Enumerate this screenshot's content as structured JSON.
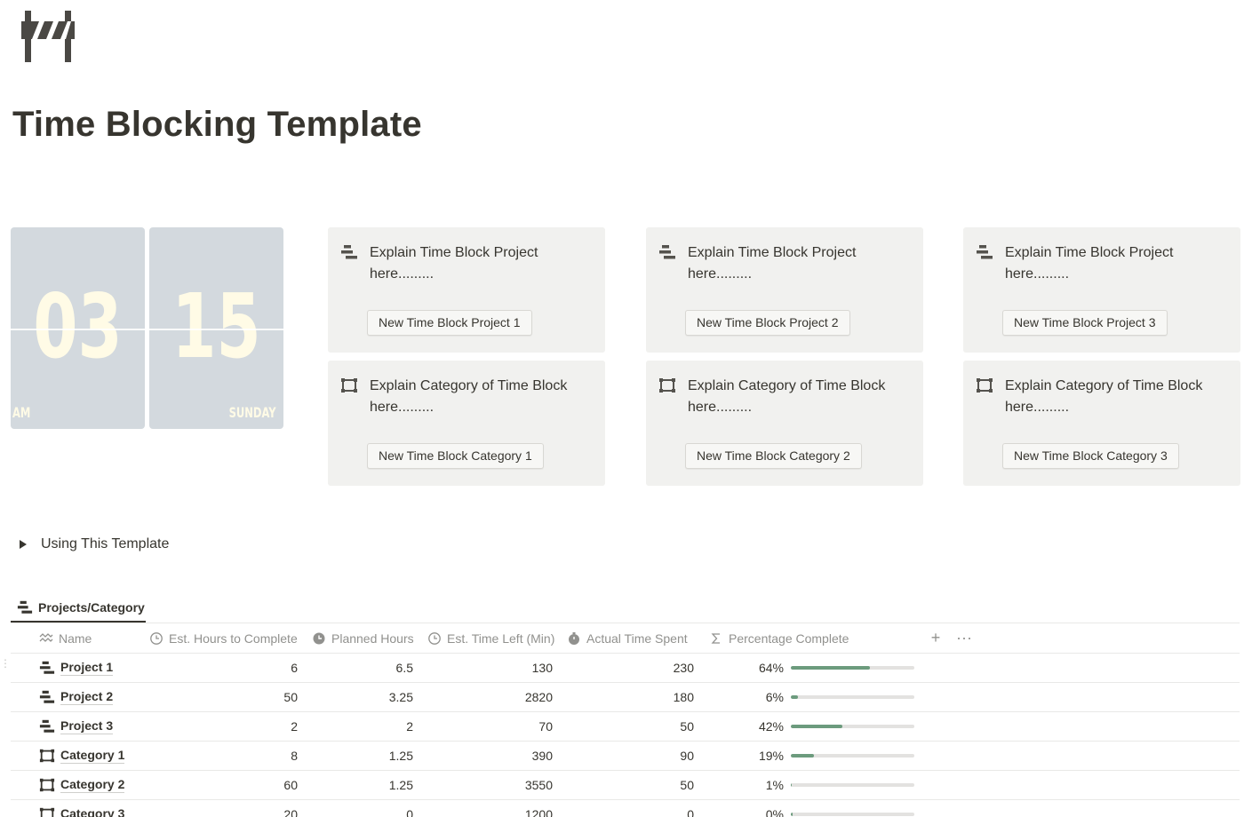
{
  "page": {
    "icon": "roadblock-icon",
    "title": "Time Blocking Template"
  },
  "clock": {
    "hour": "03",
    "minute": "15",
    "meridiem": "AM",
    "day": "SUNDAY"
  },
  "project_cards": [
    {
      "icon": "stacked-bars-icon",
      "text": "Explain Time Block Project here.........",
      "button": "New Time Block Project 1"
    },
    {
      "icon": "stacked-bars-icon",
      "text": "Explain Time Block Project here.........",
      "button": "New Time Block Project 2"
    },
    {
      "icon": "stacked-bars-icon",
      "text": "Explain Time Block Project here.........",
      "button": "New Time Block Project 3"
    }
  ],
  "category_cards": [
    {
      "icon": "frame-icon",
      "text": "Explain Category of Time Block here.........",
      "button": "New Time Block Category 1"
    },
    {
      "icon": "frame-icon",
      "text": "Explain Category of Time Block here.........",
      "button": "New Time Block Category 2"
    },
    {
      "icon": "frame-icon",
      "text": "Explain Category of Time Block here.........",
      "button": "New Time Block Category 3"
    }
  ],
  "toggle": {
    "label": "Using This Template"
  },
  "view": {
    "tab_label": "Projects/Category"
  },
  "table": {
    "columns": {
      "name": "Name",
      "est_hours": "Est. Hours to Complete",
      "planned_hours": "Planned Hours",
      "est_time_left": "Est. Time Left (Min)",
      "actual_time": "Actual Time Spent",
      "percentage": "Percentage Complete"
    },
    "rows": [
      {
        "type": "project",
        "name": "Project 1",
        "est_hours": "6",
        "planned_hours": "6.5",
        "est_time_left": "130",
        "actual_time": "230",
        "percent_label": "64%",
        "percent": 0.64
      },
      {
        "type": "project",
        "name": "Project 2",
        "est_hours": "50",
        "planned_hours": "3.25",
        "est_time_left": "2820",
        "actual_time": "180",
        "percent_label": "6%",
        "percent": 0.06
      },
      {
        "type": "project",
        "name": "Project 3",
        "est_hours": "2",
        "planned_hours": "2",
        "est_time_left": "70",
        "actual_time": "50",
        "percent_label": "42%",
        "percent": 0.42
      },
      {
        "type": "category",
        "name": "Category 1",
        "est_hours": "8",
        "planned_hours": "1.25",
        "est_time_left": "390",
        "actual_time": "90",
        "percent_label": "19%",
        "percent": 0.19
      },
      {
        "type": "category",
        "name": "Category 2",
        "est_hours": "60",
        "planned_hours": "1.25",
        "est_time_left": "3550",
        "actual_time": "50",
        "percent_label": "1%",
        "percent": 0.01
      },
      {
        "type": "category",
        "name": "Category 3",
        "est_hours": "20",
        "planned_hours": "0",
        "est_time_left": "1200",
        "actual_time": "0",
        "percent_label": "0%",
        "percent": 0.0
      }
    ]
  },
  "colors": {
    "progress_fill": "#6c9b7d",
    "progress_track": "#e3e2e0",
    "card_bg": "#f1f1ef",
    "clock_bg": "#d3d9de",
    "clock_text": "#fffbe6"
  }
}
